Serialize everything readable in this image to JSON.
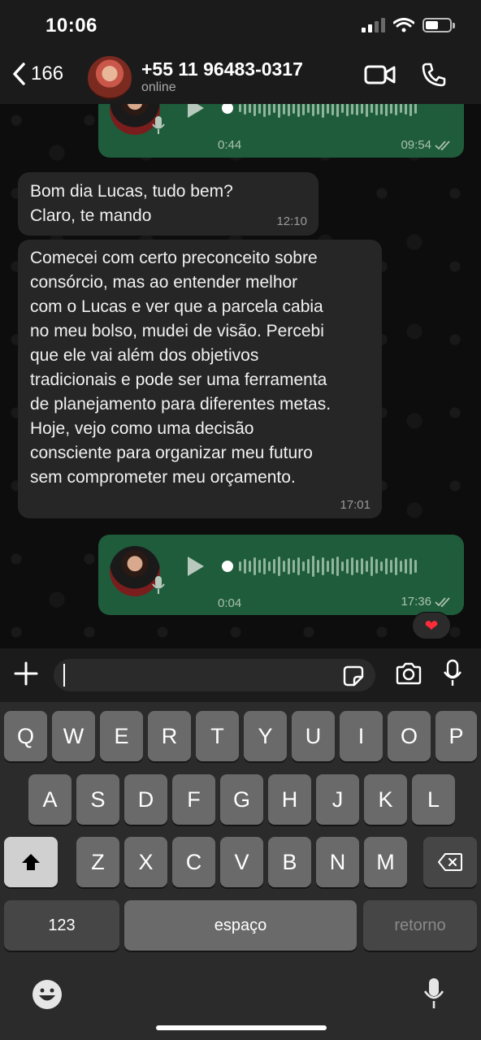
{
  "status_bar": {
    "time": "10:06"
  },
  "header": {
    "back_count": "166",
    "contact_name": "+55 11 96483-0317",
    "contact_status": "online"
  },
  "messages": [
    {
      "type": "voice",
      "direction": "out",
      "duration": "0:44",
      "time": "09:54",
      "read": true
    },
    {
      "type": "text",
      "direction": "in",
      "lines": [
        "Bom dia Lucas, tudo bem?",
        "Claro, te mando"
      ],
      "time": "12:10"
    },
    {
      "type": "text",
      "direction": "in",
      "lines": [
        "Comecei com certo preconceito sobre",
        "consórcio, mas ao entender melhor",
        "com o Lucas e ver que a parcela cabia",
        "no meu bolso, mudei de visão. Percebi",
        "que ele vai além dos objetivos",
        "tradicionais e pode ser uma ferramenta",
        "de planejamento para diferentes metas.",
        "Hoje, vejo como uma decisão",
        "consciente para organizar meu futuro",
        "sem comprometer meu orçamento."
      ],
      "time": "17:01"
    },
    {
      "type": "voice",
      "direction": "out",
      "duration": "0:04",
      "time": "17:36",
      "read": true,
      "reaction": "❤"
    }
  ],
  "input": {
    "value": ""
  },
  "keyboard": {
    "row1": [
      "Q",
      "W",
      "E",
      "R",
      "T",
      "Y",
      "U",
      "I",
      "O",
      "P"
    ],
    "row2": [
      "A",
      "S",
      "D",
      "F",
      "G",
      "H",
      "J",
      "K",
      "L"
    ],
    "row3": [
      "Z",
      "X",
      "C",
      "V",
      "B",
      "N",
      "M"
    ],
    "numbers_label": "123",
    "space_label": "espaço",
    "return_label": "retorno"
  },
  "icons": {
    "back": "chevron-left-icon",
    "video": "video-camera-icon",
    "call": "phone-icon",
    "plus": "plus-icon",
    "sticker": "sticker-icon",
    "camera": "camera-icon",
    "mic": "microphone-icon",
    "shift": "shift-arrow-icon",
    "delete": "backspace-icon",
    "emoji": "emoji-icon",
    "dictation": "dictation-mic-icon"
  },
  "colors": {
    "outgoing_bubble": "#1f5c3b",
    "incoming_bubble": "#262626",
    "reaction_heart": "#ff2b3a"
  }
}
